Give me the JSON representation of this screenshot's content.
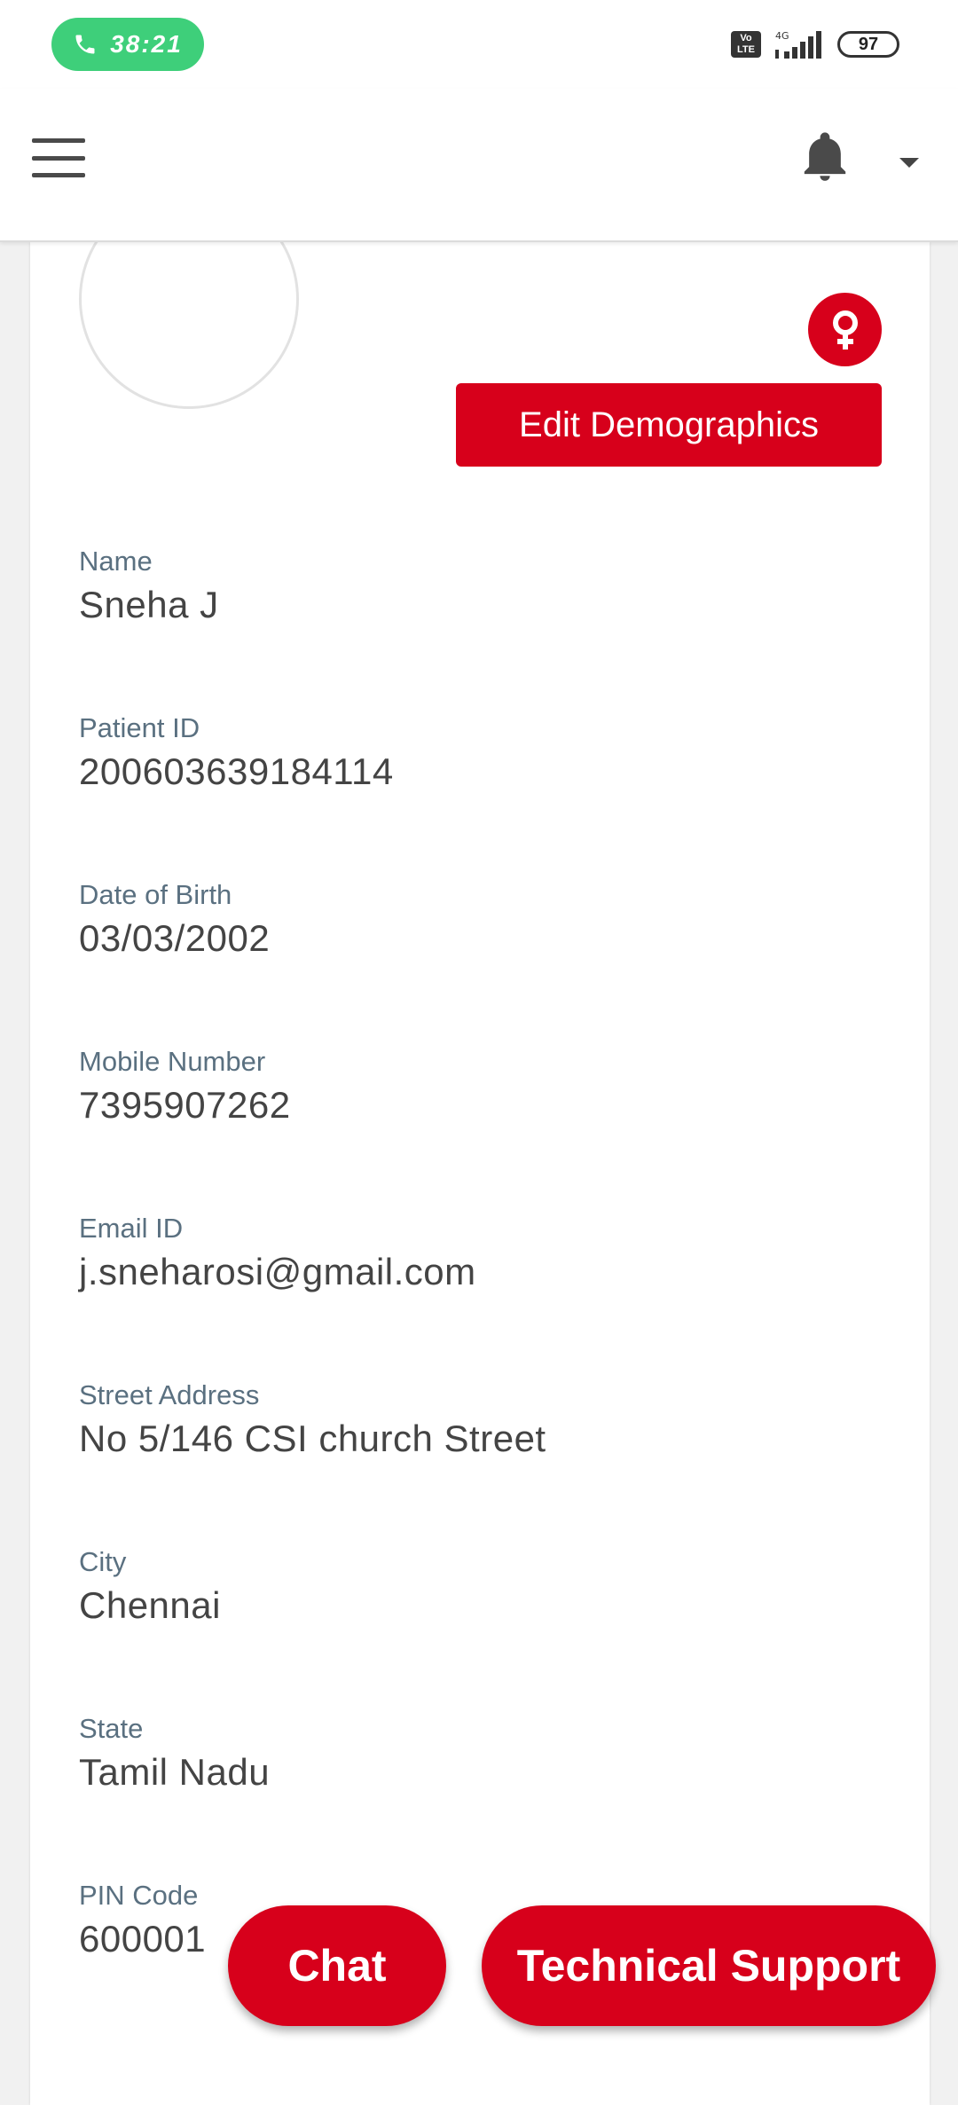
{
  "status_bar": {
    "call_timer": "38:21",
    "network_label": "VoLTE",
    "battery": "97",
    "accent_color": "#3ecf7a"
  },
  "nav": {
    "menu_icon": "hamburger-icon",
    "notification_icon": "bell-icon",
    "dropdown_icon": "caret-down-icon"
  },
  "profile": {
    "gender_icon": "female-icon",
    "edit_button_label": "Edit Demographics",
    "brand_color": "#d7001b"
  },
  "fields": [
    {
      "label": "Name",
      "value": "Sneha J"
    },
    {
      "label": "Patient ID",
      "value": "200603639184114"
    },
    {
      "label": "Date of Birth",
      "value": "03/03/2002"
    },
    {
      "label": "Mobile Number",
      "value": "7395907262"
    },
    {
      "label": "Email ID",
      "value": "j.sneharosi@gmail.com"
    },
    {
      "label": "Street Address",
      "value": "No 5/146 CSI church Street"
    },
    {
      "label": "City",
      "value": "Chennai"
    },
    {
      "label": "State",
      "value": "Tamil Nadu"
    },
    {
      "label": "PIN Code",
      "value": "600001"
    }
  ],
  "actions": {
    "chat_label": "Chat",
    "support_label": "Technical Support"
  }
}
